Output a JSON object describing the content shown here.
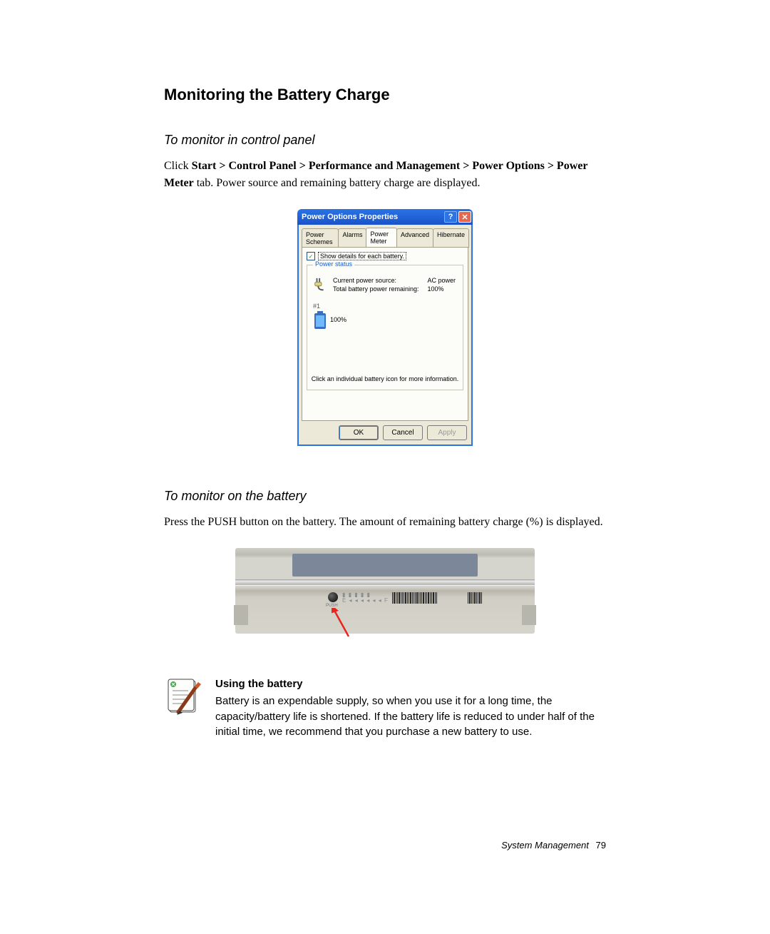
{
  "heading_main": "Monitoring the Battery Charge",
  "section1": {
    "title": "To monitor in control panel",
    "intro_pre": "Click ",
    "intro_bold": "Start > Control Panel > Performance and Management > Power Options > Power Meter",
    "intro_post": " tab. Power source and remaining battery charge are displayed."
  },
  "dialog": {
    "title": "Power Options Properties",
    "tabs": {
      "schemes": "Power Schemes",
      "alarms": "Alarms",
      "meter": "Power Meter",
      "advanced": "Advanced",
      "hibernate": "Hibernate"
    },
    "checkbox_label": "Show details for each battery.",
    "group_title": "Power status",
    "current_source_label": "Current power source:",
    "current_source_value": "AC power",
    "total_remaining_label": "Total battery power remaining:",
    "total_remaining_value": "100%",
    "battery_num": "#1",
    "battery_pct": "100%",
    "hint": "Click an individual battery icon for more information.",
    "ok": "OK",
    "cancel": "Cancel",
    "apply": "Apply"
  },
  "section2": {
    "title": "To monitor on the battery",
    "text": "Press the PUSH button on the battery. The amount of remaining battery charge (%) is displayed."
  },
  "battery_photo": {
    "push_label": "PUSH"
  },
  "note": {
    "title": "Using the battery",
    "body": "Battery is an expendable supply, so when you use it for a long time, the capacity/battery life is shortened. If the battery life is reduced to under half of the initial time, we recommend that you purchase a new battery to use."
  },
  "footer": {
    "label": "System Management",
    "page": "79"
  }
}
